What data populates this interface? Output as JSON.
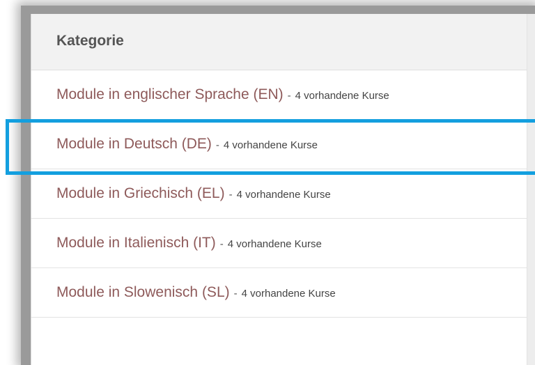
{
  "table": {
    "header": "Kategorie",
    "rows": [
      {
        "name": "Module in englischer Sprache (EN)",
        "separator": "-",
        "count": "4 vorhandene Kurse"
      },
      {
        "name": "Module in Deutsch (DE)",
        "separator": "-",
        "count": "4 vorhandene Kurse"
      },
      {
        "name": "Module in Griechisch (EL)",
        "separator": "-",
        "count": "4 vorhandene Kurse"
      },
      {
        "name": "Module in Italienisch (IT)",
        "separator": "-",
        "count": "4 vorhandene Kurse"
      },
      {
        "name": "Module in Slowenisch (SL)",
        "separator": "-",
        "count": "4 vorhandene Kurse"
      }
    ]
  },
  "highlight": {
    "row_index": 1,
    "color": "#139fdf"
  },
  "colors": {
    "category_link": "#8e5a5a",
    "header_background": "#f2f2f2",
    "header_text": "#555555"
  }
}
